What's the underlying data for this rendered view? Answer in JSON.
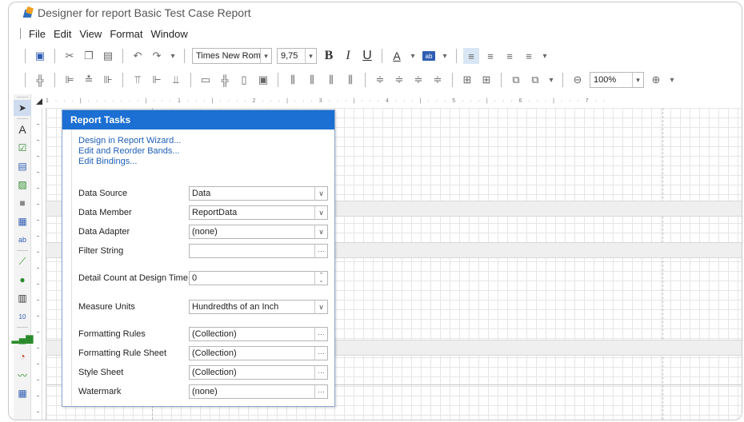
{
  "window": {
    "title": "Designer for report Basic Test Case Report"
  },
  "menu": {
    "items": [
      "File",
      "Edit",
      "View",
      "Format",
      "Window"
    ]
  },
  "toolbar": {
    "font_name": "Times New Roman",
    "font_size": "9,75",
    "bold": "B",
    "italic": "I",
    "underline": "U",
    "font_color_glyph": "A",
    "highlight_glyph": "ab",
    "zoom": "100%"
  },
  "ruler": {
    "text": "1 · · · | · · · · · · · | · · · 1 · · · | · · · · 2 · · · | · · · 3 · · · | · · · 4 · · · | · · · 5 · · · | · · · 6 · · · | · · · 7 · ·"
  },
  "report_tasks": {
    "title": "Report Tasks",
    "links": [
      "Design in Report Wizard...",
      "Edit and Reorder Bands...",
      "Edit Bindings..."
    ],
    "properties": [
      {
        "label": "Data Source",
        "value": "Data",
        "button": "v"
      },
      {
        "label": "Data Member",
        "value": "ReportData",
        "button": "v"
      },
      {
        "label": "Data Adapter",
        "value": "(none)",
        "button": "v"
      },
      {
        "label": "Filter String",
        "value": "",
        "button": "..."
      },
      {
        "label": "Detail Count at Design Time",
        "value": "0",
        "button": "^v"
      },
      {
        "label": "Measure Units",
        "value": "Hundredths of an Inch",
        "button": "v"
      },
      {
        "label": "Formatting Rules",
        "value": "(Collection)",
        "button": "..."
      },
      {
        "label": "Formatting Rule Sheet",
        "value": "(Collection)",
        "button": "..."
      },
      {
        "label": "Style Sheet",
        "value": "(Collection)",
        "button": "..."
      },
      {
        "label": "Watermark",
        "value": "(none)",
        "button": "..."
      }
    ]
  },
  "colors": {
    "accent": "#1c6fd3",
    "link": "#1f5fb6"
  }
}
